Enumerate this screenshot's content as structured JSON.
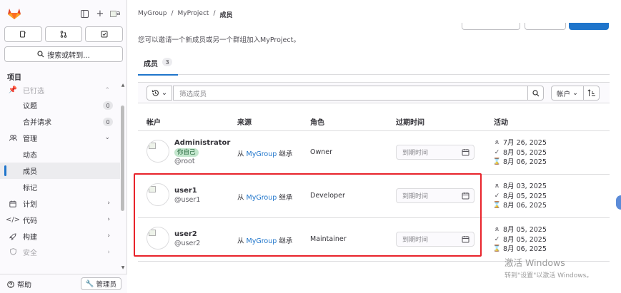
{
  "sidebar": {
    "avatar_alt": "a",
    "search_label": "搜索或转到...",
    "section_title": "项目",
    "items": [
      {
        "label": "已钉选",
        "type": "cat-faded"
      },
      {
        "label": "议题",
        "count": "0"
      },
      {
        "label": "合并请求",
        "count": "0"
      },
      {
        "label": "管理",
        "type": "cat",
        "icon": "users-icon",
        "expanded": true
      },
      {
        "label": "动态"
      },
      {
        "label": "成员",
        "active": true
      },
      {
        "label": "标记"
      },
      {
        "label": "计划",
        "type": "cat",
        "icon": "calendar-icon"
      },
      {
        "label": "代码",
        "type": "cat",
        "icon": "code-icon"
      },
      {
        "label": "构建",
        "type": "cat",
        "icon": "rocket-icon"
      },
      {
        "label": "安全",
        "type": "cat-faded",
        "icon": "shield-icon"
      }
    ],
    "help_label": "帮助",
    "admin_label": "管理员"
  },
  "breadcrumb": {
    "group": "MyGroup",
    "project": "MyProject",
    "current": "成员"
  },
  "description": "您可以邀请一个新成员或另一个群组加入MyProject。",
  "tabs": [
    {
      "label": "成员",
      "count": "3"
    }
  ],
  "filter": {
    "placeholder": "筛选成员",
    "sort_label": "帐户"
  },
  "table": {
    "headers": {
      "account": "帐户",
      "source": "来源",
      "role": "角色",
      "expiration": "过期时间",
      "activity": "活动"
    },
    "rows": [
      {
        "name": "Administrator",
        "you_badge": "你自己",
        "username": "@root",
        "source_prefix": "从",
        "source_group": "MyGroup",
        "source_suffix": "继承",
        "role": "Owner",
        "expiration_placeholder": "到期时间",
        "activity": [
          "7月 26, 2025",
          "8月 05, 2025",
          "8月 06, 2025"
        ]
      },
      {
        "name": "user1",
        "username": "@user1",
        "source_prefix": "从",
        "source_group": "MyGroup",
        "source_suffix": "继承",
        "role": "Developer",
        "expiration_placeholder": "到期时间",
        "activity": [
          "8月 03, 2025",
          "8月 05, 2025",
          "8月 06, 2025"
        ]
      },
      {
        "name": "user2",
        "username": "@user2",
        "source_prefix": "从",
        "source_group": "MyGroup",
        "source_suffix": "继承",
        "role": "Maintainer",
        "expiration_placeholder": "到期时间",
        "activity": [
          "8月 05, 2025",
          "8月 05, 2025",
          "8月 06, 2025"
        ]
      }
    ]
  },
  "watermark": {
    "line1": "激活 Windows",
    "line2": "转到\"设置\"以激活 Windows。"
  },
  "colors": {
    "accent": "#1f75cb",
    "highlight": "#e8232b",
    "logo": "#e24329"
  }
}
